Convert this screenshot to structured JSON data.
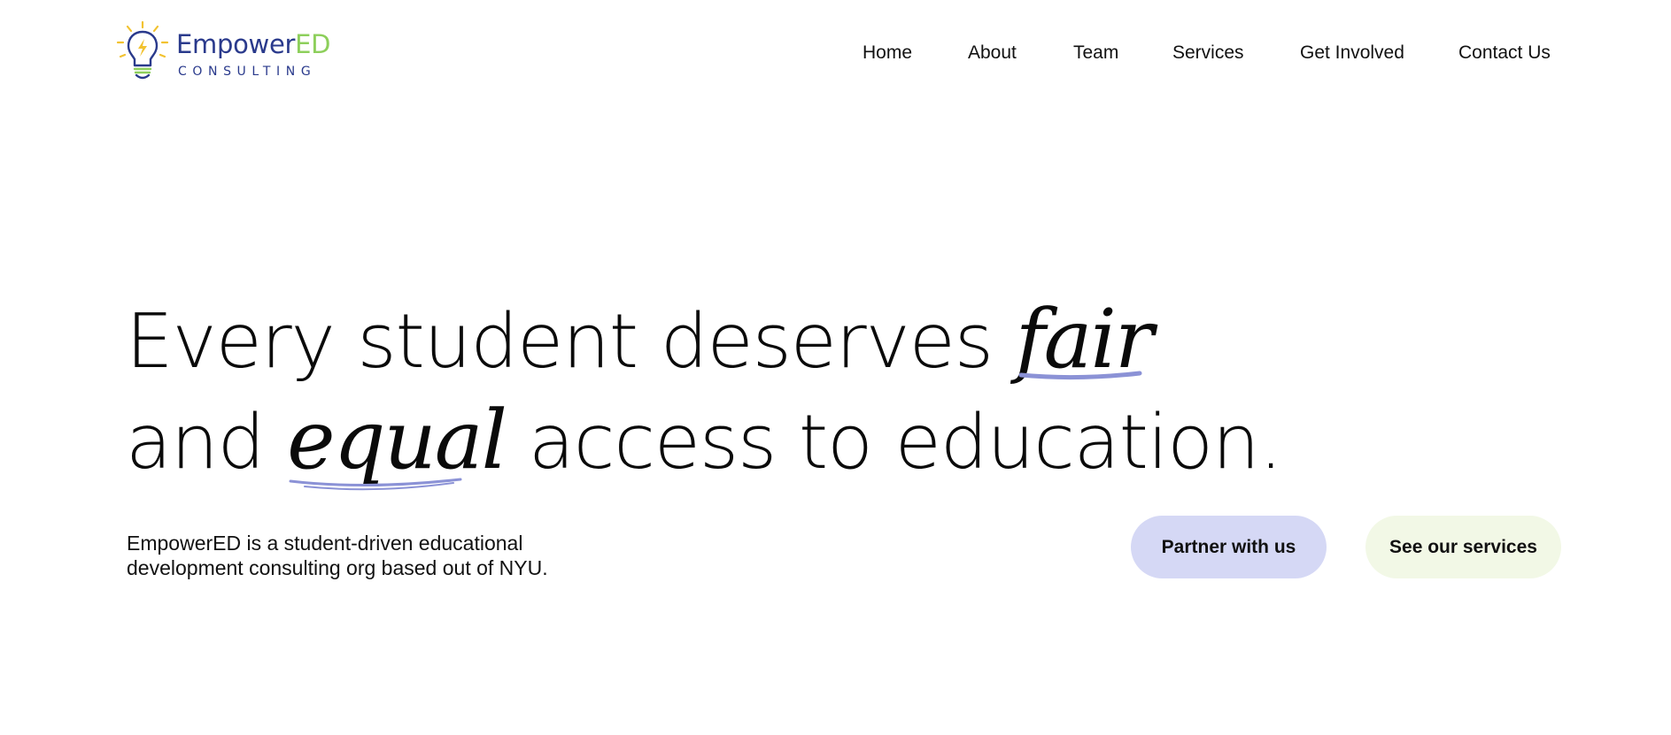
{
  "brand": {
    "name_part1": "Empower",
    "name_part2": "ED",
    "subtitle": "CONSULTING",
    "colors": {
      "navy": "#2a3a8c",
      "green": "#8dcf5b",
      "bulb_yellow": "#f2c230"
    },
    "icon": "lightbulb-icon"
  },
  "nav": {
    "items": [
      {
        "label": "Home"
      },
      {
        "label": "About"
      },
      {
        "label": "Team"
      },
      {
        "label": "Services"
      },
      {
        "label": "Get Involved"
      },
      {
        "label": "Contact Us"
      }
    ]
  },
  "hero": {
    "line1_prefix": "Every student deserves ",
    "line1_script": "fair",
    "line2_prefix": "and ",
    "line2_script": "equal",
    "line2_suffix": " access to education.",
    "underline_color": "#8b92d6"
  },
  "tagline": {
    "line1": "EmpowerED is a student-driven educational",
    "line2": "development consulting org based out of NYU."
  },
  "buttons": {
    "partner": {
      "label": "Partner with us",
      "bg": "#d5d8f5"
    },
    "services": {
      "label": "See our services",
      "bg": "#f2f8e6"
    }
  }
}
